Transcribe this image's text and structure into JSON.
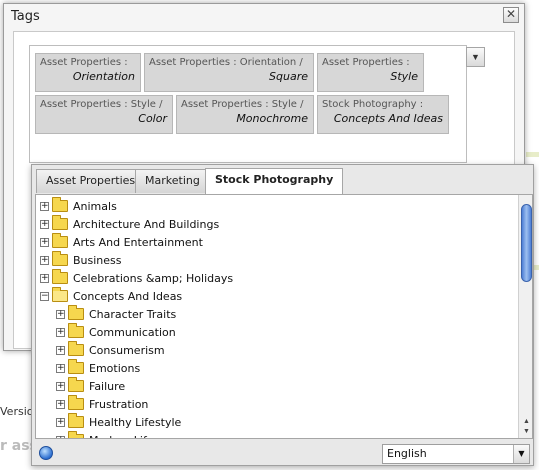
{
  "background": {
    "version_label": "Version",
    "faded_text": "r ass"
  },
  "dialog": {
    "title": "Tags",
    "close_glyph": "✕"
  },
  "selected_tags": [
    {
      "namespace": "Asset Properties :",
      "tag": "Orientation"
    },
    {
      "namespace": "Asset Properties : Orientation /",
      "tag": "Square"
    },
    {
      "namespace": "Asset Properties :",
      "tag": "Style"
    },
    {
      "namespace": "Asset Properties : Style /",
      "tag": "Color"
    },
    {
      "namespace": "Asset Properties : Style /",
      "tag": "Monochrome"
    },
    {
      "namespace": "Stock Photography :",
      "tag": "Concepts And Ideas"
    }
  ],
  "field_toggle_glyph": "▼",
  "picker": {
    "tabs": [
      {
        "label": "Asset Properties",
        "active": false
      },
      {
        "label": "Marketing",
        "active": false
      },
      {
        "label": "Stock Photography",
        "active": true
      }
    ],
    "tree": [
      {
        "label": "Animals",
        "level": 0,
        "expanded": false
      },
      {
        "label": "Architecture And Buildings",
        "level": 0,
        "expanded": false
      },
      {
        "label": "Arts And Entertainment",
        "level": 0,
        "expanded": false
      },
      {
        "label": "Business",
        "level": 0,
        "expanded": false
      },
      {
        "label": "Celebrations &amp; Holidays",
        "level": 0,
        "expanded": false
      },
      {
        "label": "Concepts And Ideas",
        "level": 0,
        "expanded": true
      },
      {
        "label": "Character Traits",
        "level": 1,
        "expanded": false
      },
      {
        "label": "Communication",
        "level": 1,
        "expanded": false
      },
      {
        "label": "Consumerism",
        "level": 1,
        "expanded": false
      },
      {
        "label": "Emotions",
        "level": 1,
        "expanded": false
      },
      {
        "label": "Failure",
        "level": 1,
        "expanded": false
      },
      {
        "label": "Frustration",
        "level": 1,
        "expanded": false
      },
      {
        "label": "Healthy Lifestyle",
        "level": 1,
        "expanded": false
      },
      {
        "label": "Modern Life",
        "level": 1,
        "expanded": false
      }
    ],
    "scroll_up_glyph": "▲",
    "scroll_down_glyph": "▼",
    "language": {
      "selected": "English",
      "arrow_glyph": "▼"
    }
  },
  "icons": {
    "expander_plus": "+",
    "expander_minus": "−",
    "globe": "globe-icon",
    "folder": "folder-icon"
  },
  "colors": {
    "folder_fill": "#f6d74e",
    "scroll_thumb": "#4d7fd5",
    "chip_bg": "#d7d7d7"
  }
}
